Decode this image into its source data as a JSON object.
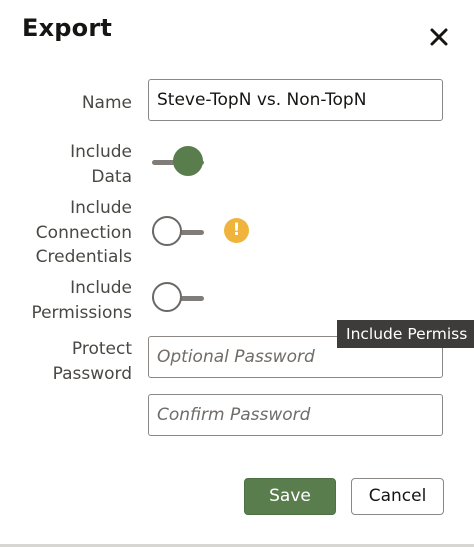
{
  "dialog": {
    "title": "Export",
    "close_icon": "close-icon"
  },
  "form": {
    "name": {
      "label": "Name",
      "value": "Steve-TopN vs. Non-TopN"
    },
    "include_data": {
      "label_line1": "Include",
      "label_line2": "Data",
      "state": "on"
    },
    "include_credentials": {
      "label_line1": "Include",
      "label_line2": "Connection",
      "label_line3": "Credentials",
      "state": "off",
      "warning_icon": "warning-icon",
      "warning_glyph": "!"
    },
    "include_permissions": {
      "label_line1": "Include",
      "label_line2": "Permissions",
      "state": "off"
    },
    "protect_password": {
      "label_line1": "Protect",
      "label_line2": "Password",
      "placeholder": "Optional Password",
      "value": ""
    },
    "confirm_password": {
      "placeholder": "Confirm Password",
      "value": ""
    }
  },
  "tooltip": {
    "text": "Include Permiss"
  },
  "buttons": {
    "save_label": "Save",
    "cancel_label": "Cancel"
  },
  "colors": {
    "accent_green": "#5a7d4e",
    "warning": "#f0b43c",
    "tooltip_bg": "#3d3c3a"
  }
}
